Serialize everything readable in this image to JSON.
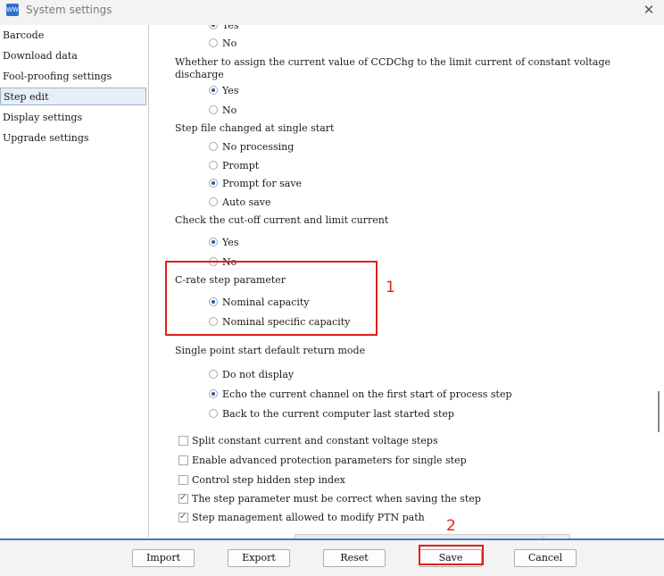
{
  "window": {
    "title": "System settings",
    "icon": "app-logo-icon"
  },
  "sidebar": {
    "items": [
      {
        "label": "Barcode"
      },
      {
        "label": "Download data"
      },
      {
        "label": "Fool-proofing settings"
      },
      {
        "label": "Step edit",
        "selected": true
      },
      {
        "label": "Display settings"
      },
      {
        "label": "Upgrade settings"
      }
    ]
  },
  "content": {
    "top_partial": {
      "option_yes": "Yes",
      "option_no": "No",
      "selected": "Yes"
    },
    "ccdchg": {
      "question": "Whether to assign the current value of CCDChg to the limit current of constant voltage discharge",
      "options": [
        "Yes",
        "No"
      ],
      "selected": "Yes"
    },
    "step_file": {
      "question": "Step file changed at single start",
      "options": [
        "No processing",
        "Prompt",
        "Prompt for save",
        "Auto save"
      ],
      "selected": "Prompt for save"
    },
    "cutoff": {
      "question": "Check the cut-off current and limit current",
      "options": [
        "Yes",
        "No"
      ],
      "selected": "Yes"
    },
    "crate": {
      "question": "C-rate step parameter",
      "options": [
        "Nominal capacity",
        "Nominal specific capacity"
      ],
      "selected": "Nominal capacity"
    },
    "single_point": {
      "question": "Single point start default return mode",
      "options": [
        "Do not display",
        "Echo the current channel on the first start of process step",
        "Back to the current computer last started step"
      ],
      "selected": "Echo the current channel on the first start of process step"
    },
    "checkboxes": [
      {
        "label": "Split constant current and constant voltage steps",
        "checked": false
      },
      {
        "label": "Enable advanced protection parameters for single step",
        "checked": false
      },
      {
        "label": "Control step hidden step index",
        "checked": false
      },
      {
        "label": "The step parameter must be correct when saving the step",
        "checked": true
      },
      {
        "label": "Step management allowed to modify PTN path",
        "checked": true
      }
    ]
  },
  "annotations": {
    "box1_label": "1",
    "box2_label": "2",
    "color": "#e0201b"
  },
  "footer": {
    "import": "Import",
    "export": "Export",
    "reset": "Reset",
    "save": "Save",
    "cancel": "Cancel"
  },
  "colors": {
    "accent": "#3e7fc4",
    "radio_dot": "#1e5fa8",
    "selection": "#e6eef7"
  }
}
